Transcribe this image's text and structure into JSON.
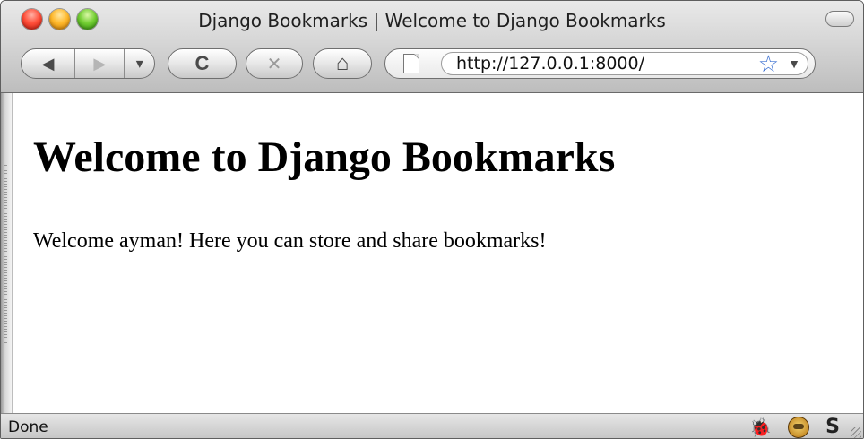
{
  "window": {
    "title": "Django Bookmarks | Welcome to Django Bookmarks"
  },
  "toolbar": {
    "back_icon": "◀",
    "forward_icon": "▶",
    "history_dropdown_icon": "▾",
    "reload_icon": "C",
    "stop_icon": "✕",
    "home_icon": "⌂",
    "url": "http://127.0.0.1:8000/",
    "bookmark_star_icon": "☆",
    "bookmark_dropdown_icon": "▼"
  },
  "page": {
    "heading": "Welcome to Django Bookmarks",
    "message": "Welcome ayman! Here you can store and share bookmarks!"
  },
  "status_bar": {
    "text": "Done",
    "bug_icon": "🪳",
    "s_icon": "S"
  },
  "colors": {
    "link_star": "#3a6fd1",
    "close": "#ff4f3a",
    "minimize": "#ffb92c",
    "zoom": "#74cf34"
  }
}
